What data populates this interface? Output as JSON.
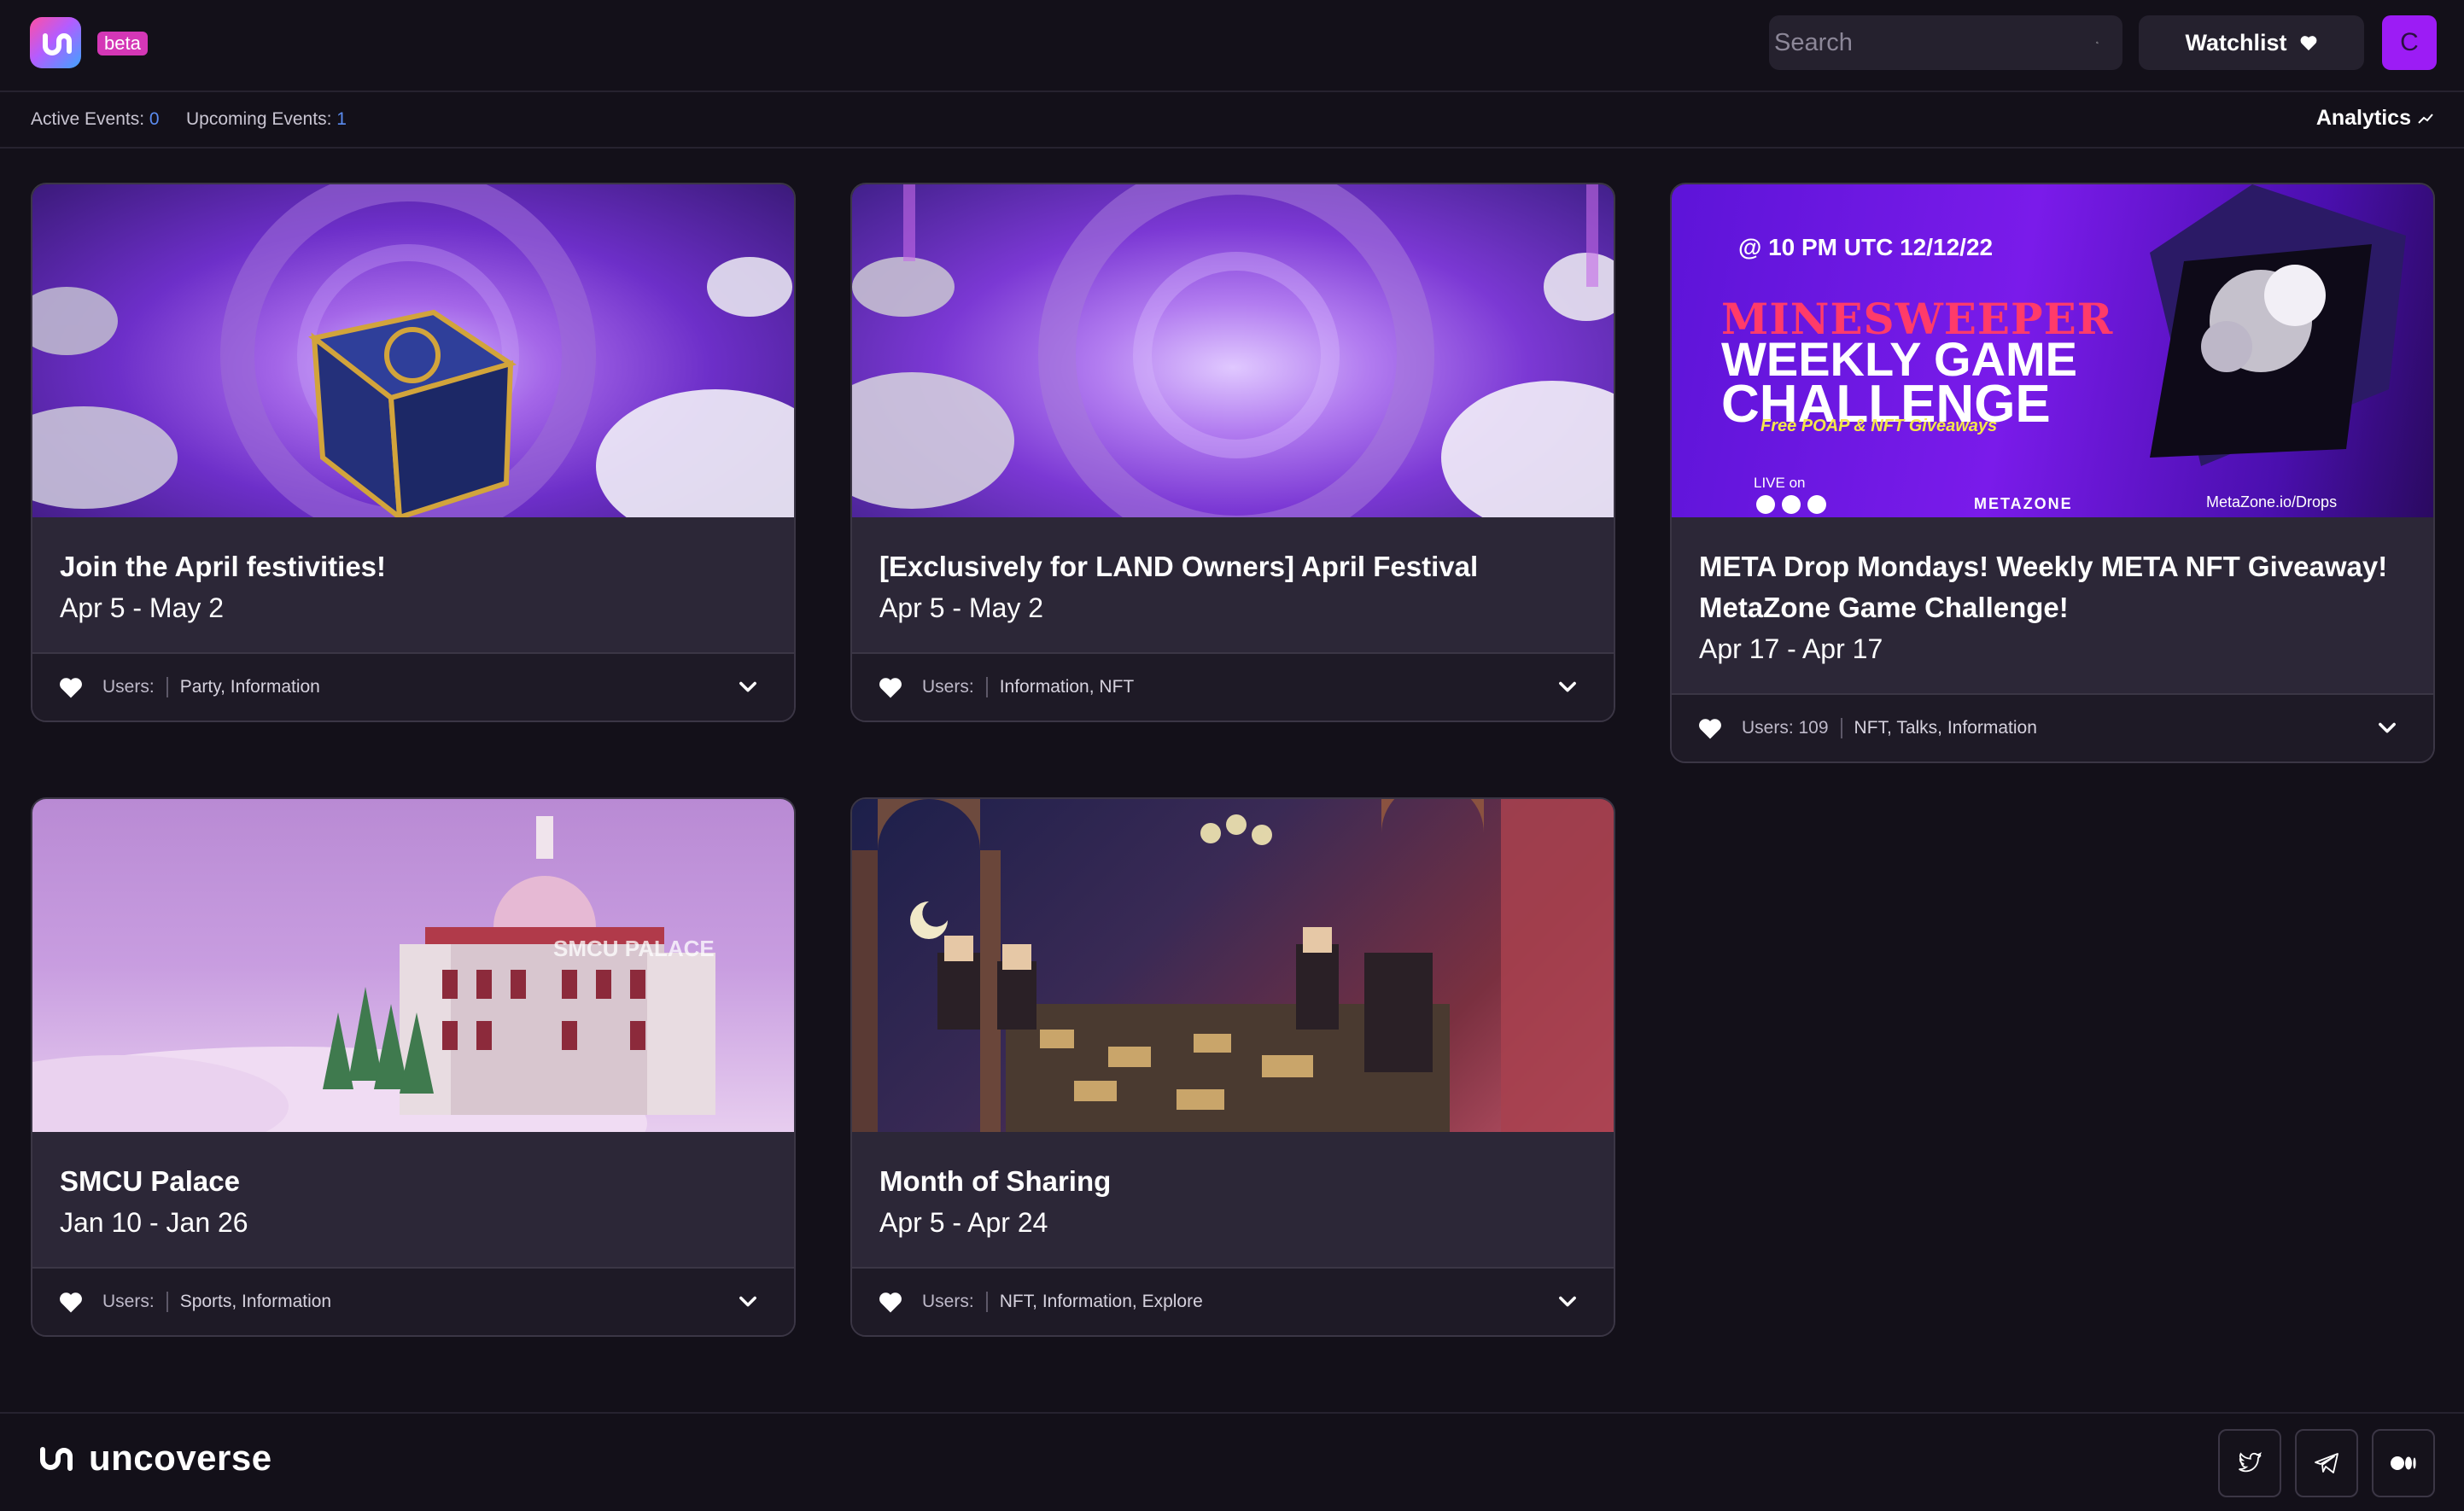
{
  "header": {
    "beta_label": "beta",
    "search_placeholder": "Search",
    "watchlist_label": "Watchlist",
    "avatar_initial": "C"
  },
  "stats": {
    "active_label": "Active Events:",
    "active_count": "0",
    "upcoming_label": "Upcoming Events:",
    "upcoming_count": "1",
    "analytics_label": "Analytics"
  },
  "events": [
    {
      "title": "Join the April festivities!",
      "dates": "Apr 5 - May 2",
      "users_label": "Users:",
      "tags": "Party, Information"
    },
    {
      "title": "[Exclusively for LAND Owners] April Festival",
      "dates": "Apr 5 - May 2",
      "users_label": "Users:",
      "tags": "Information, NFT"
    },
    {
      "title": "META Drop Mondays! Weekly META NFT Giveaway! MetaZone Game Challenge!",
      "dates": "Apr 17 - Apr 17",
      "users_label": "Users: 109",
      "tags": "NFT, Talks, Information",
      "banner": {
        "time": "@ 10 PM UTC 12/12/22",
        "line1": "MINESWEEPER",
        "line2": "WEEKLY GAME",
        "line3": "CHALLENGE",
        "sub": "Free POAP & NFT Giveaways",
        "live": "LIVE on",
        "brand": "METAZONE",
        "url": "MetaZone.io/Drops"
      }
    },
    {
      "title": "SMCU Palace",
      "dates": "Jan 10 - Jan 26",
      "users_label": "Users:",
      "tags": "Sports, Information",
      "banner_text": "SMCU PALACE"
    },
    {
      "title": "Month of Sharing",
      "dates": "Apr 5 - Apr 24",
      "users_label": "Users:",
      "tags": "NFT, Information, Explore"
    }
  ],
  "footer": {
    "brand_name": "uncoverse"
  },
  "icons": {
    "search": "search-icon",
    "heart": "heart-icon",
    "chevron": "chevron-down-icon",
    "analytics": "trend-icon",
    "twitter": "twitter-icon",
    "telegram": "telegram-icon",
    "medium": "medium-icon"
  },
  "colors": {
    "background": "#131019",
    "card_body": "#2c2737",
    "accent_purple": "#9c1cf5",
    "beta_pink": "#d437b6",
    "link_blue": "#5b8cf0"
  }
}
